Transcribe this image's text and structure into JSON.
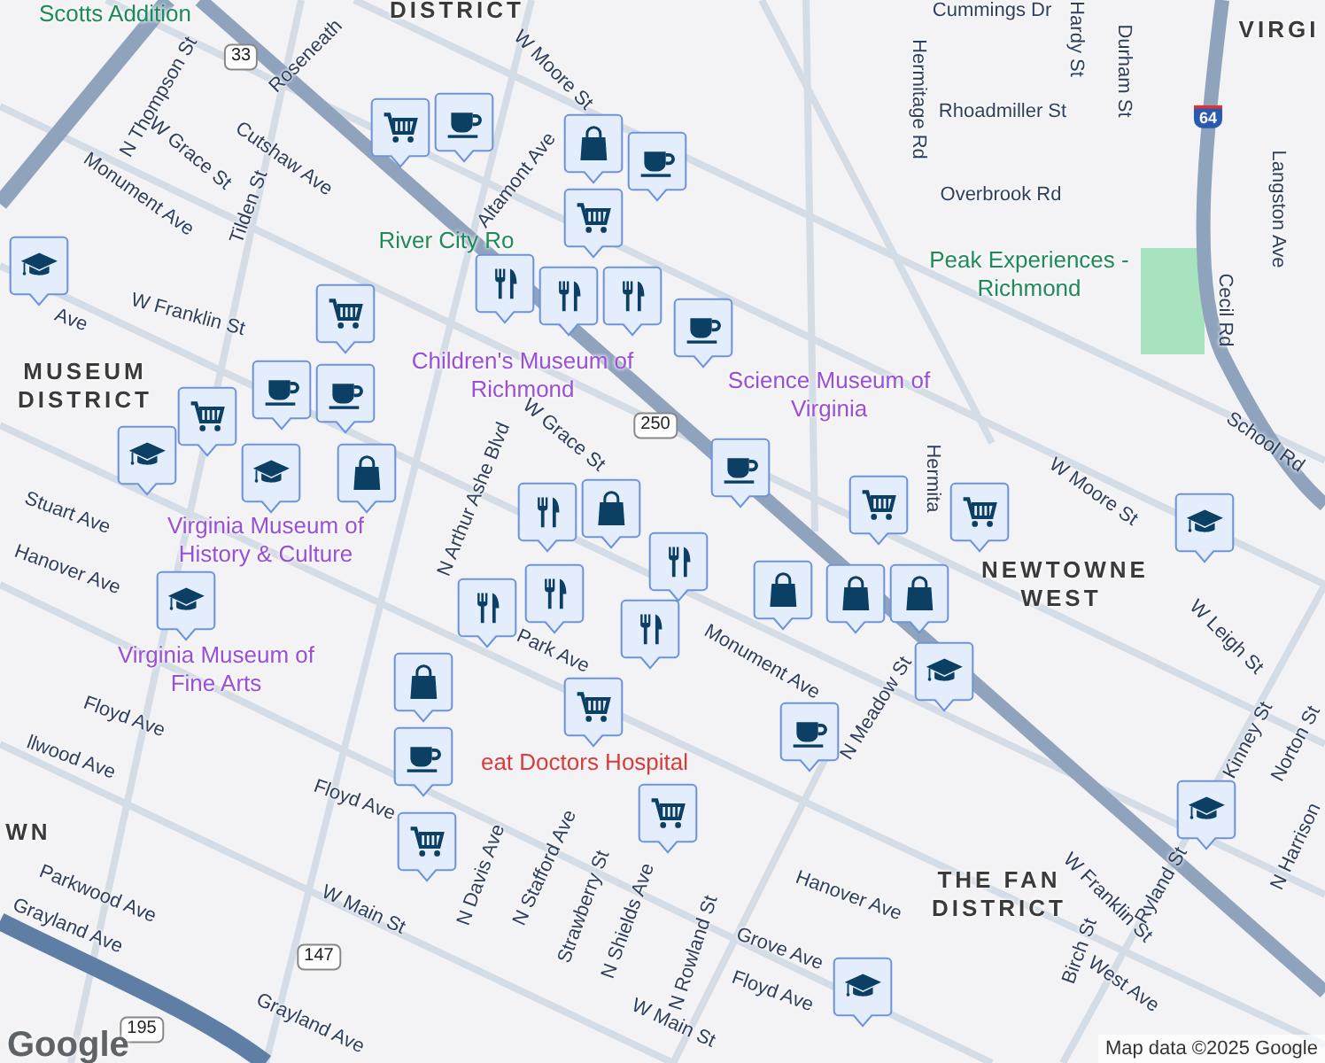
{
  "map": {
    "labels": [
      {
        "text": "Scotts Addition",
        "kind": "park"
      },
      {
        "text": "DISTRICT",
        "kind": "district"
      },
      {
        "text": "VIRGI",
        "kind": "district"
      },
      {
        "text": "Cummings Dr",
        "kind": "street"
      },
      {
        "text": "Hardy St",
        "kind": "street"
      },
      {
        "text": "Durham St",
        "kind": "street"
      },
      {
        "text": "Hermitage Rd",
        "kind": "street"
      },
      {
        "text": "Rhoadmiller St",
        "kind": "street"
      },
      {
        "text": "Overbrook Rd",
        "kind": "street"
      },
      {
        "text": "Langston Ave",
        "kind": "street"
      },
      {
        "text": "Peak Experiences - Richmond",
        "kind": "park"
      },
      {
        "text": "Cecil Rd",
        "kind": "street"
      },
      {
        "text": "School Rd",
        "kind": "street"
      },
      {
        "text": "W Moore St",
        "kind": "street"
      },
      {
        "text": "Hermita",
        "kind": "street"
      },
      {
        "text": "Science Museum of Virginia",
        "kind": "museum"
      },
      {
        "text": "N Thompson St",
        "kind": "street"
      },
      {
        "text": "Roseneath",
        "kind": "street"
      },
      {
        "text": "W Grace St",
        "kind": "street"
      },
      {
        "text": "Cutshaw Ave",
        "kind": "street"
      },
      {
        "text": "Tilden St",
        "kind": "street"
      },
      {
        "text": "Monument Ave",
        "kind": "street"
      },
      {
        "text": "W Moore St",
        "kind": "street"
      },
      {
        "text": "Altamont Ave",
        "kind": "street"
      },
      {
        "text": "River City Ro",
        "kind": "park"
      },
      {
        "text": "W Franklin St",
        "kind": "street"
      },
      {
        "text": "Ave",
        "kind": "street"
      },
      {
        "text": "MUSEUM DISTRICT",
        "kind": "district"
      },
      {
        "text": "Children's Museum of Richmond",
        "kind": "museum"
      },
      {
        "text": "N Arthur Ashe Blvd",
        "kind": "street"
      },
      {
        "text": "W Grace St",
        "kind": "street"
      },
      {
        "text": "Stuart Ave",
        "kind": "street"
      },
      {
        "text": "Hanover Ave",
        "kind": "street"
      },
      {
        "text": "Virginia Museum of History & Culture",
        "kind": "museum"
      },
      {
        "text": "Park Ave",
        "kind": "street"
      },
      {
        "text": "Virginia Museum of Fine Arts",
        "kind": "museum"
      },
      {
        "text": "Floyd Ave",
        "kind": "street"
      },
      {
        "text": "llwood Ave",
        "kind": "street"
      },
      {
        "text": "eat Doctors Hospital",
        "kind": "hospital"
      },
      {
        "text": "Floyd Ave",
        "kind": "street"
      },
      {
        "text": "WN",
        "kind": "district"
      },
      {
        "text": "Parkwood Ave",
        "kind": "street"
      },
      {
        "text": "Grayland Ave",
        "kind": "street"
      },
      {
        "text": "W Main St",
        "kind": "street"
      },
      {
        "text": "N Davis Ave",
        "kind": "street"
      },
      {
        "text": "N Stafford Ave",
        "kind": "street"
      },
      {
        "text": "Strawberry St",
        "kind": "street"
      },
      {
        "text": "N Shields Ave",
        "kind": "street"
      },
      {
        "text": "N Rowland St",
        "kind": "street"
      },
      {
        "text": "Grayland Ave",
        "kind": "street"
      },
      {
        "text": "W Main St",
        "kind": "street"
      },
      {
        "text": "Monument Ave",
        "kind": "street"
      },
      {
        "text": "N Meadow St",
        "kind": "street"
      },
      {
        "text": "NEWTOWNE WEST",
        "kind": "district"
      },
      {
        "text": "W Leigh St",
        "kind": "street"
      },
      {
        "text": "Kinney St",
        "kind": "street"
      },
      {
        "text": "Norton St",
        "kind": "street"
      },
      {
        "text": "N Harrison",
        "kind": "street"
      },
      {
        "text": "Hanover Ave",
        "kind": "street"
      },
      {
        "text": "THE FAN DISTRICT",
        "kind": "district"
      },
      {
        "text": "W Franklin St",
        "kind": "street"
      },
      {
        "text": "Ryland St",
        "kind": "street"
      },
      {
        "text": "Birch St",
        "kind": "street"
      },
      {
        "text": "West Ave",
        "kind": "street"
      },
      {
        "text": "Grove Ave",
        "kind": "street"
      },
      {
        "text": "Floyd Ave",
        "kind": "street"
      },
      {
        "text": "33",
        "kind": "route"
      },
      {
        "text": "250",
        "kind": "route"
      },
      {
        "text": "147",
        "kind": "route"
      },
      {
        "text": "195",
        "kind": "route"
      },
      {
        "text": "64",
        "kind": "interstate"
      }
    ],
    "pins": [
      {
        "kind": "cart"
      },
      {
        "kind": "cup"
      },
      {
        "kind": "bag"
      },
      {
        "kind": "cup"
      },
      {
        "kind": "cart"
      },
      {
        "kind": "fork"
      },
      {
        "kind": "fork"
      },
      {
        "kind": "fork"
      },
      {
        "kind": "cup"
      },
      {
        "kind": "cap"
      },
      {
        "kind": "cart"
      },
      {
        "kind": "cup"
      },
      {
        "kind": "cup"
      },
      {
        "kind": "cart"
      },
      {
        "kind": "cap"
      },
      {
        "kind": "bag"
      },
      {
        "kind": "cap"
      },
      {
        "kind": "cap"
      },
      {
        "kind": "fork"
      },
      {
        "kind": "bag"
      },
      {
        "kind": "cup"
      },
      {
        "kind": "cart"
      },
      {
        "kind": "cart"
      },
      {
        "kind": "bag"
      },
      {
        "kind": "bag"
      },
      {
        "kind": "bag"
      },
      {
        "kind": "cap"
      },
      {
        "kind": "cup"
      },
      {
        "kind": "fork"
      },
      {
        "kind": "fork"
      },
      {
        "kind": "fork"
      },
      {
        "kind": "fork"
      },
      {
        "kind": "bag"
      },
      {
        "kind": "cup"
      },
      {
        "kind": "cart"
      },
      {
        "kind": "cart"
      },
      {
        "kind": "cart"
      },
      {
        "kind": "cap"
      },
      {
        "kind": "cap"
      },
      {
        "kind": "cap"
      }
    ]
  },
  "logo": "Google",
  "attribution": "Map data ©2025 Google"
}
